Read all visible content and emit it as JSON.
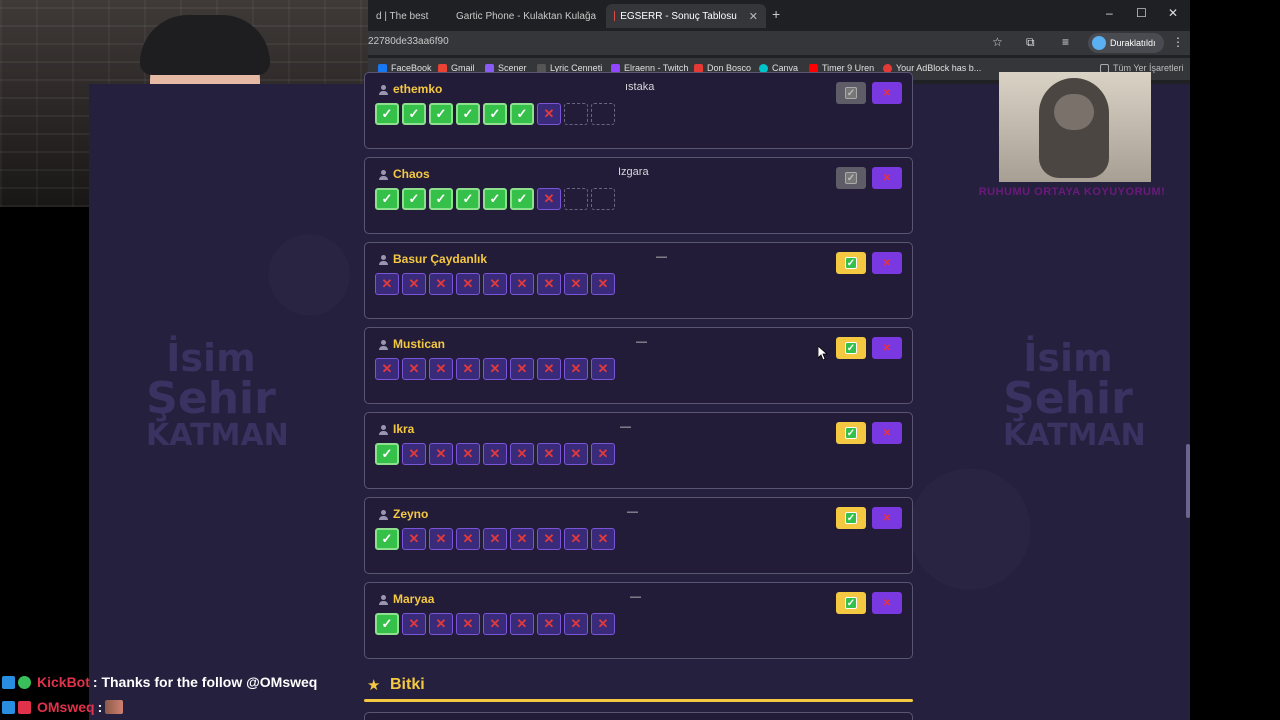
{
  "browser": {
    "tabs": [
      {
        "title": "d | The best",
        "active": false
      },
      {
        "title": "Gartic Phone - Kulaktan Kulağa",
        "active": false
      },
      {
        "title": "EGSERR - Sonuç Tablosu",
        "active": true
      }
    ],
    "new_tab": "+",
    "window_controls": {
      "minimize": "–",
      "maximize": "☐",
      "close": "✕"
    },
    "address": "22780de33aa6f90",
    "profile_label": "Duraklatıldı",
    "bookmarks": [
      {
        "label": "FaceBook",
        "color": "#1877f2"
      },
      {
        "label": "Gmail",
        "color": "#ea4335"
      },
      {
        "label": "Scener",
        "color": "#8a5cf6"
      },
      {
        "label": "Lyric Cenneti",
        "color": "#555555"
      },
      {
        "label": "Elraenn - Twitch",
        "color": "#9146ff"
      },
      {
        "label": "Don Bosco",
        "color": "#e53935"
      },
      {
        "label": "Canva",
        "color": "#00c4cc"
      },
      {
        "label": "Timer 9 Uren",
        "color": "#ff0000"
      },
      {
        "label": "Your AdBlock has b...",
        "color": "#e53935"
      }
    ],
    "all_bookmarks": "Tüm Yer İşaretleri"
  },
  "players": [
    {
      "name": "ethemko",
      "answer": "ıstaka",
      "ok_enabled": false,
      "boxes": [
        "ok",
        "ok",
        "ok",
        "ok",
        "ok",
        "ok",
        "no",
        "empty",
        "empty"
      ]
    },
    {
      "name": "Chaos",
      "answer": "Izgara",
      "ok_enabled": false,
      "boxes": [
        "ok",
        "ok",
        "ok",
        "ok",
        "ok",
        "ok",
        "no",
        "empty",
        "empty"
      ]
    },
    {
      "name": "Basur Çaydanlık",
      "answer": "—",
      "ok_enabled": true,
      "boxes": [
        "no",
        "no",
        "no",
        "no",
        "no",
        "no",
        "no",
        "no",
        "no"
      ]
    },
    {
      "name": "Mustican",
      "answer": "—",
      "ok_enabled": true,
      "boxes": [
        "no",
        "no",
        "no",
        "no",
        "no",
        "no",
        "no",
        "no",
        "no"
      ]
    },
    {
      "name": "Ikra",
      "answer": "—",
      "ok_enabled": true,
      "boxes": [
        "ok",
        "no",
        "no",
        "no",
        "no",
        "no",
        "no",
        "no",
        "no"
      ]
    },
    {
      "name": "Zeyno",
      "answer": "—",
      "ok_enabled": true,
      "boxes": [
        "ok",
        "no",
        "no",
        "no",
        "no",
        "no",
        "no",
        "no",
        "no"
      ]
    },
    {
      "name": "Maryaa",
      "answer": "—",
      "ok_enabled": true,
      "boxes": [
        "ok",
        "no",
        "no",
        "no",
        "no",
        "no",
        "no",
        "no",
        "no"
      ]
    }
  ],
  "section_title": "Bitki",
  "background_logo": {
    "line1": "İsim",
    "line2": "Şehir",
    "line3": "KATMAN"
  },
  "overlay_caption": "RUHUMU ORTAYA KOYUYORUM!",
  "glyphs": {
    "check": "✓",
    "cross": "✕",
    "star": "★"
  },
  "chat": [
    {
      "user": "KickBot",
      "user_color": "#e0324a",
      "message": ": Thanks for the follow @OMsweq"
    },
    {
      "user": "OMsweq",
      "user_color": "#e0324a",
      "message": ":"
    }
  ],
  "colors": {
    "accent_yellow": "#f5c842",
    "accent_purple": "#7a38e0",
    "ok_green": "#35c04a",
    "page_bg": "#26203f"
  }
}
